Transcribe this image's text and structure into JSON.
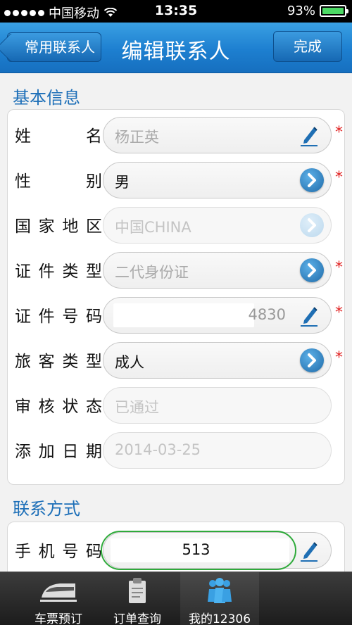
{
  "status_bar": {
    "carrier": "中国移动",
    "time": "13:35",
    "battery": "93%"
  },
  "nav": {
    "back_label": "常用联系人",
    "title": "编辑联系人",
    "done_label": "完成"
  },
  "sections": {
    "basic": "基本信息",
    "contact": "联系方式"
  },
  "fields": {
    "name": {
      "label": "姓名",
      "value": "杨正英"
    },
    "gender": {
      "label": "性别",
      "value": "男"
    },
    "country": {
      "label": "国家地区",
      "value": "中国CHINA"
    },
    "id_type": {
      "label": "证件类型",
      "value": "二代身份证"
    },
    "id_number": {
      "label": "证件号码",
      "value": "4830"
    },
    "passenger_type": {
      "label": "旅客类型",
      "value": "成人"
    },
    "review_status": {
      "label": "审核状态",
      "value": "已通过"
    },
    "date_added": {
      "label": "添加日期",
      "value": "2014-03-25"
    },
    "phone": {
      "label": "手机号码",
      "value": "513"
    }
  },
  "required_mark": "*",
  "tabs": [
    {
      "label": "车票预订",
      "icon": "train-icon"
    },
    {
      "label": "订单查询",
      "icon": "clipboard-icon"
    },
    {
      "label": "我的12306",
      "icon": "people-icon"
    }
  ],
  "colors": {
    "nav_blue": "#1d7fd0",
    "section_blue": "#1d6fb8",
    "required_red": "#e02020",
    "phone_highlight": "#2eaa3a"
  }
}
